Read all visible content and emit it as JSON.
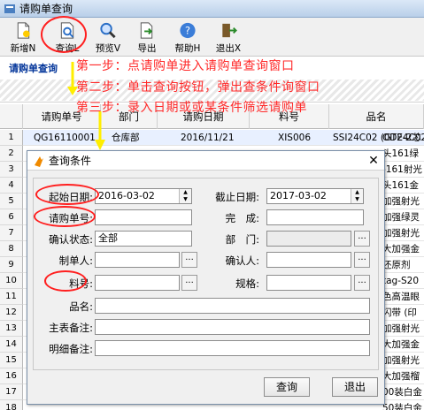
{
  "window": {
    "title": "请购单查询"
  },
  "toolbar": {
    "buttons": [
      {
        "label": "新增N",
        "icon": "new-document-icon"
      },
      {
        "label": "查询L",
        "icon": "query-icon"
      },
      {
        "label": "预览V",
        "icon": "preview-magnifier-icon"
      },
      {
        "label": "导出",
        "icon": "export-icon"
      },
      {
        "label": "帮助H",
        "icon": "help-icon"
      },
      {
        "label": "退出X",
        "icon": "exit-icon"
      }
    ]
  },
  "subtitle": "请购单查询",
  "annotations": {
    "step1": "第一步：点请购单进入请购单查询窗口",
    "step2": "第二步：单击查询按钮，弹出查条件询窗口",
    "step3": "第三步：录入日期或或某条件筛选请购单"
  },
  "grid": {
    "columns": [
      "请购单号",
      "部门",
      "请购日期",
      "料号",
      "品名"
    ],
    "row_numbers": [
      "1",
      "2",
      "3",
      "4",
      "5",
      "6",
      "7",
      "8",
      "9",
      "10",
      "11",
      "12",
      "13",
      "14",
      "15",
      "16",
      "17",
      "18"
    ],
    "first_row": {
      "order_no": "QG16110001",
      "dept": "仓库部",
      "date": "2016/11/21",
      "part": "XIS006",
      "name": "SSI24C02 (GT24C02"
    },
    "right_fragments": [
      "ODE-2芯",
      "头161绿",
      "-161射光",
      "头161金",
      "加强射光",
      "加强绿灵",
      "加强射光",
      "大加强金",
      "还原剂",
      "tag-S20",
      "色高温眼",
      "闪带 (印",
      "加强射光",
      "大加强金",
      "加强射光",
      "大加强榴",
      "00装白金",
      "50装白金"
    ]
  },
  "dialog": {
    "title": "查询条件",
    "close": "✕",
    "fields": {
      "start_date_label": "起始日期:",
      "start_date": "2016-03-02",
      "end_date_label": "截止日期:",
      "end_date": "2017-03-02",
      "order_no_label": "请购单号:",
      "complete_label": "完　成:",
      "confirm_status_label": "确认状态:",
      "confirm_status": "全部",
      "dept_label": "部　门:",
      "maker_label": "制单人:",
      "confirmer_label": "确认人:",
      "part_label": "料号:",
      "spec_label": "规格:",
      "name_label": "品名:",
      "main_remark_label": "主表备注:",
      "detail_remark_label": "明细备注:"
    },
    "buttons": {
      "query": "查询",
      "exit": "退出"
    }
  },
  "colors": {
    "annotation": "#ff2a2a",
    "subtitle": "#003399",
    "highlight_circle": "#ff1f1f",
    "arrow": "#ffee00"
  }
}
